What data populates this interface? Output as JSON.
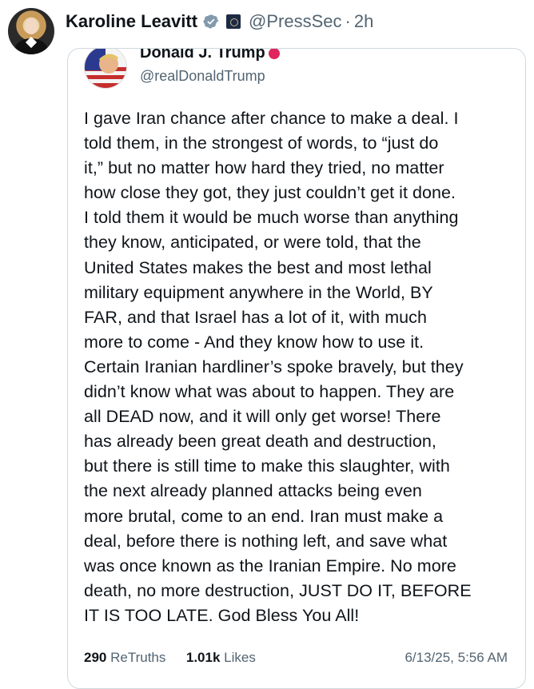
{
  "post": {
    "author_name": "Karoline Leavitt",
    "author_handle": "@PressSec",
    "separator": "·",
    "timestamp": "2h"
  },
  "quoted": {
    "author_name": "Donald J. Trump",
    "author_handle": "@realDonaldTrump",
    "body": "I gave Iran chance after chance to make a deal. I\ntold them, in the strongest of words, to “just do\nit,” but no matter how hard they tried, no matter\nhow close they got, they just couldn’t get it done.\nI told them it would be much worse than anything\nthey know, anticipated, or were told, that the\nUnited States makes the best and most lethal\nmilitary equipment anywhere in the World, BY\nFAR, and that Israel has a lot of it, with much\nmore to come - And they know how to use it.\nCertain Iranian hardliner’s spoke bravely, but they\ndidn’t know what was about to happen. They are\nall DEAD now, and it will only get worse! There\nhas already been great death and destruction,\nbut there is still time to make this slaughter, with\nthe next already planned attacks being even\nmore brutal, come to an end. Iran must make a\ndeal, before there is nothing left, and save what\nwas once known as the Iranian Empire. No more\ndeath, no more destruction, JUST DO IT, BEFORE\nIT IS TOO LATE. God Bless You All!",
    "retruths_count": "290",
    "retruths_label": "ReTruths",
    "likes_count": "1.01k",
    "likes_label": "Likes",
    "date": "6/13/25, 5:56 AM"
  },
  "colors": {
    "verified_blue": "#1d9bf0",
    "muted_text": "#536471",
    "truth_verified": "#e0245e"
  },
  "icons": {
    "verified": "verified-check-icon",
    "gov_affiliate": "government-badge-icon",
    "truth_verified": "truth-verified-icon"
  }
}
